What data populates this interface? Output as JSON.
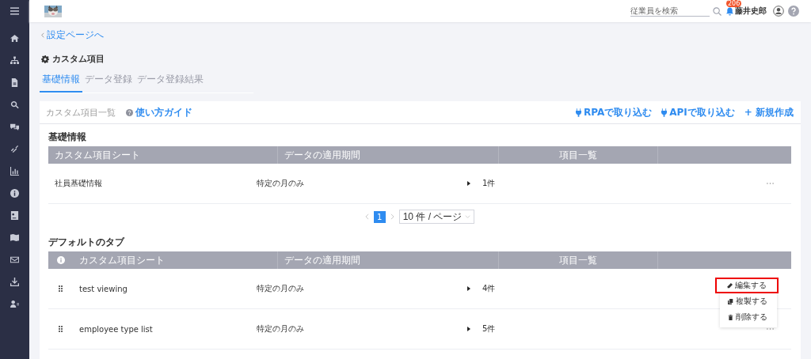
{
  "header": {
    "search": {
      "placeholder": "従業員を検索"
    },
    "notifications": {
      "badge": "206"
    },
    "user": {
      "name": "藤井史郎"
    }
  },
  "back_link": "設定ページへ",
  "page_title": "カスタム項目",
  "tabs": [
    {
      "label": "基礎情報",
      "selected": true
    },
    {
      "label": "データ登録",
      "selected": false
    },
    {
      "label": "データ登録結果",
      "selected": false
    }
  ],
  "card": {
    "title": "カスタム項目一覧",
    "guide_link": "使い方ガイド",
    "actions": [
      {
        "label": "RPAで取り込む",
        "kind": "plug"
      },
      {
        "label": "APIで取り込む",
        "kind": "plug"
      },
      {
        "label": "+ 新規作成",
        "kind": "plain"
      }
    ],
    "sections": [
      {
        "title": "基礎情報",
        "info_column": false,
        "columns": [
          "カスタム項目シート",
          "データの適用期間",
          "項目一覧"
        ],
        "rows": [
          {
            "sheet": "社員基礎情報",
            "period": "特定の月のみ",
            "count": "1件",
            "menu_open": false
          }
        ],
        "pagination": {
          "pages": [
            {
              "label": "1",
              "selected": true
            }
          ],
          "page_size": "10 件 / ページ"
        }
      },
      {
        "title": "デフォルトのタブ",
        "info_column": true,
        "columns": [
          "カスタム項目シート",
          "データの適用期間",
          "項目一覧"
        ],
        "rows": [
          {
            "sheet": "test viewing",
            "period": "特定の月のみ",
            "count": "4件",
            "draggable": true,
            "menu_open": true
          },
          {
            "sheet": "employee type list",
            "period": "特定の月のみ",
            "count": "5件",
            "draggable": true,
            "menu_open": false
          }
        ]
      }
    ]
  },
  "context_menu": {
    "items": [
      {
        "label": "編集する",
        "kind": "edit",
        "highlighted": true
      },
      {
        "label": "複製する",
        "kind": "copy",
        "highlighted": false
      },
      {
        "label": "削除する",
        "kind": "delete",
        "highlighted": false
      }
    ]
  }
}
